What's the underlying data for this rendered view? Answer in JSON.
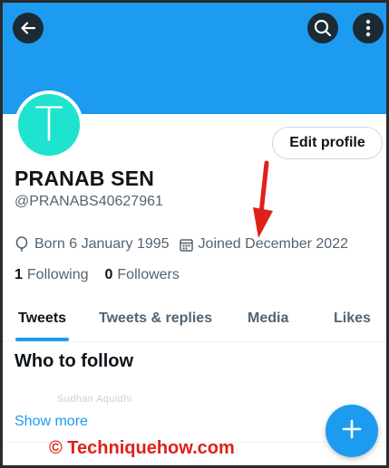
{
  "colors": {
    "banner": "#1d9bf0",
    "accent": "#1d9bf0",
    "avatar": "#1ee3cf",
    "annotation_arrow": "#e0201a",
    "watermark": "#e0201a"
  },
  "header": {
    "back_icon": "arrow-left-icon",
    "search_icon": "search-icon",
    "more_icon": "more-vertical-icon"
  },
  "profile": {
    "avatar_letter": "T",
    "edit_label": "Edit profile",
    "name": "PRANAB SEN",
    "handle": "@PRANABS40627961",
    "born": "Born 6 January 1995",
    "joined": "Joined December 2022",
    "following_count": "1",
    "following_label": "Following",
    "followers_count": "0",
    "followers_label": "Followers"
  },
  "tabs": [
    {
      "label": "Tweets",
      "active": true
    },
    {
      "label": "Tweets & replies",
      "active": false
    },
    {
      "label": "Media",
      "active": false
    },
    {
      "label": "Likes",
      "active": false
    }
  ],
  "who_to_follow": {
    "title": "Who to follow",
    "ghost_text": "Sudhan Aquidhi",
    "show_more": "Show more"
  },
  "watermark": "© Techniquehow.com",
  "fab_icon": "plus-icon"
}
